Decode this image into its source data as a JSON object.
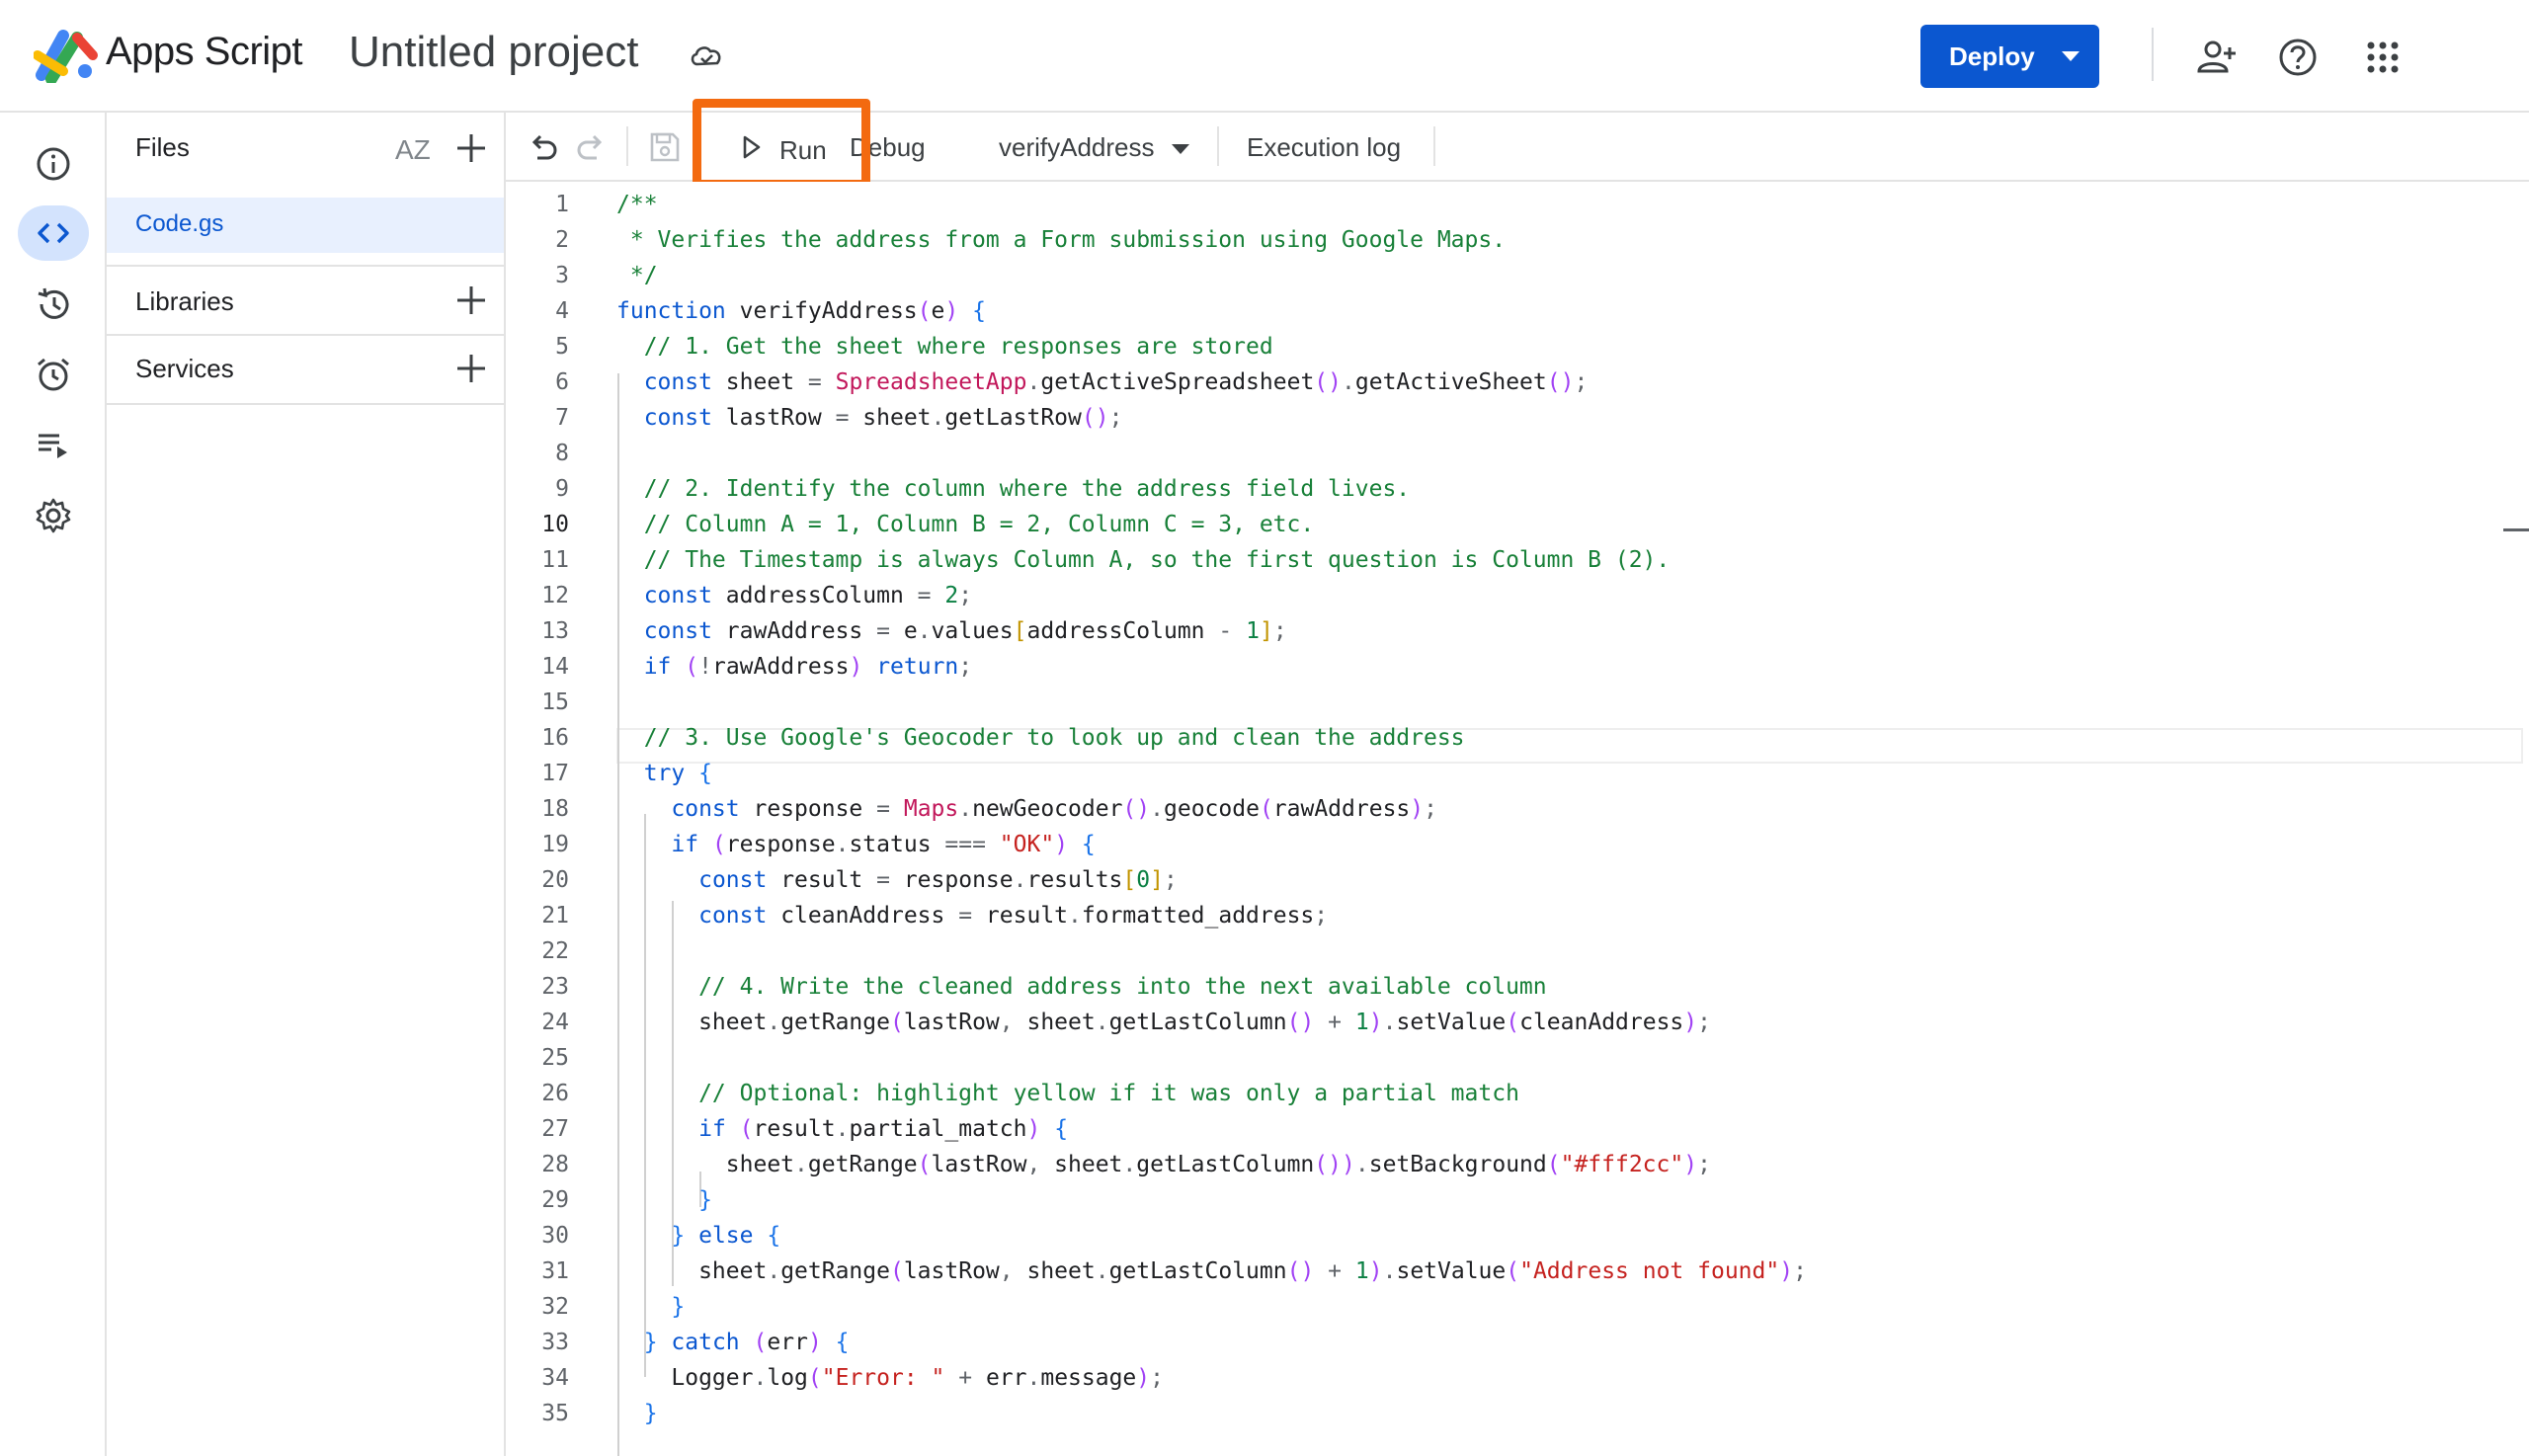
{
  "header": {
    "app_name": "Apps Script",
    "project_title": "Untitled project",
    "deploy_label": "Deploy",
    "icons": [
      "apps-script-logo",
      "cloud-saved-icon",
      "add-person-icon",
      "help-icon",
      "apps-grid-icon"
    ]
  },
  "rail": {
    "items": [
      "overview-icon",
      "editor-icon",
      "history-icon",
      "triggers-icon",
      "executions-icon",
      "settings-icon"
    ],
    "active": "editor-icon"
  },
  "files_panel": {
    "files_heading": "Files",
    "sort_label": "AZ",
    "file_name": "Code.gs",
    "libraries_heading": "Libraries",
    "services_heading": "Services"
  },
  "toolbar": {
    "run_label": "Run",
    "debug_label": "Debug",
    "function_select": "verifyAddress",
    "execution_log_label": "Execution log"
  },
  "colors": {
    "accent": "#0b57d0",
    "highlight": "#f36a10",
    "comment": "#188038",
    "keyword": "#0b57d0",
    "string": "#c5221f"
  },
  "editor": {
    "current_line": 10,
    "lines": [
      {
        "num": "1",
        "text": "/**"
      },
      {
        "num": "2",
        "text": " * Verifies the address from a Form submission using Google Maps."
      },
      {
        "num": "3",
        "text": " */"
      },
      {
        "num": "4",
        "text": "function verifyAddress(e) {"
      },
      {
        "num": "5",
        "text": "  // 1. Get the sheet where responses are stored"
      },
      {
        "num": "6",
        "text": "  const sheet = SpreadsheetApp.getActiveSpreadsheet().getActiveSheet();"
      },
      {
        "num": "7",
        "text": "  const lastRow = sheet.getLastRow();"
      },
      {
        "num": "8",
        "text": ""
      },
      {
        "num": "9",
        "text": "  // 2. Identify the column where the address field lives."
      },
      {
        "num": "10",
        "text": "  // Column A = 1, Column B = 2, Column C = 3, etc."
      },
      {
        "num": "11",
        "text": "  // The Timestamp is always Column A, so the first question is Column B (2)."
      },
      {
        "num": "12",
        "text": "  const addressColumn = 2;"
      },
      {
        "num": "13",
        "text": "  const rawAddress = e.values[addressColumn - 1];"
      },
      {
        "num": "14",
        "text": "  if (!rawAddress) return;"
      },
      {
        "num": "15",
        "text": ""
      },
      {
        "num": "16",
        "text": "  // 3. Use Google's Geocoder to look up and clean the address"
      },
      {
        "num": "17",
        "text": "  try {"
      },
      {
        "num": "18",
        "text": "    const response = Maps.newGeocoder().geocode(rawAddress);"
      },
      {
        "num": "19",
        "text": "    if (response.status === \"OK\") {"
      },
      {
        "num": "20",
        "text": "      const result = response.results[0];"
      },
      {
        "num": "21",
        "text": "      const cleanAddress = result.formatted_address;"
      },
      {
        "num": "22",
        "text": ""
      },
      {
        "num": "23",
        "text": "      // 4. Write the cleaned address into the next available column"
      },
      {
        "num": "24",
        "text": "      sheet.getRange(lastRow, sheet.getLastColumn() + 1).setValue(cleanAddress);"
      },
      {
        "num": "25",
        "text": ""
      },
      {
        "num": "26",
        "text": "      // Optional: highlight yellow if it was only a partial match"
      },
      {
        "num": "27",
        "text": "      if (result.partial_match) {"
      },
      {
        "num": "28",
        "text": "        sheet.getRange(lastRow, sheet.getLastColumn()).setBackground(\"#fff2cc\");"
      },
      {
        "num": "29",
        "text": "      }"
      },
      {
        "num": "30",
        "text": "    } else {"
      },
      {
        "num": "31",
        "text": "      sheet.getRange(lastRow, sheet.getLastColumn() + 1).setValue(\"Address not found\");"
      },
      {
        "num": "32",
        "text": "    }"
      },
      {
        "num": "33",
        "text": "  } catch (err) {"
      },
      {
        "num": "34",
        "text": "    Logger.log(\"Error: \" + err.message);"
      },
      {
        "num": "35",
        "text": "  }"
      }
    ]
  }
}
